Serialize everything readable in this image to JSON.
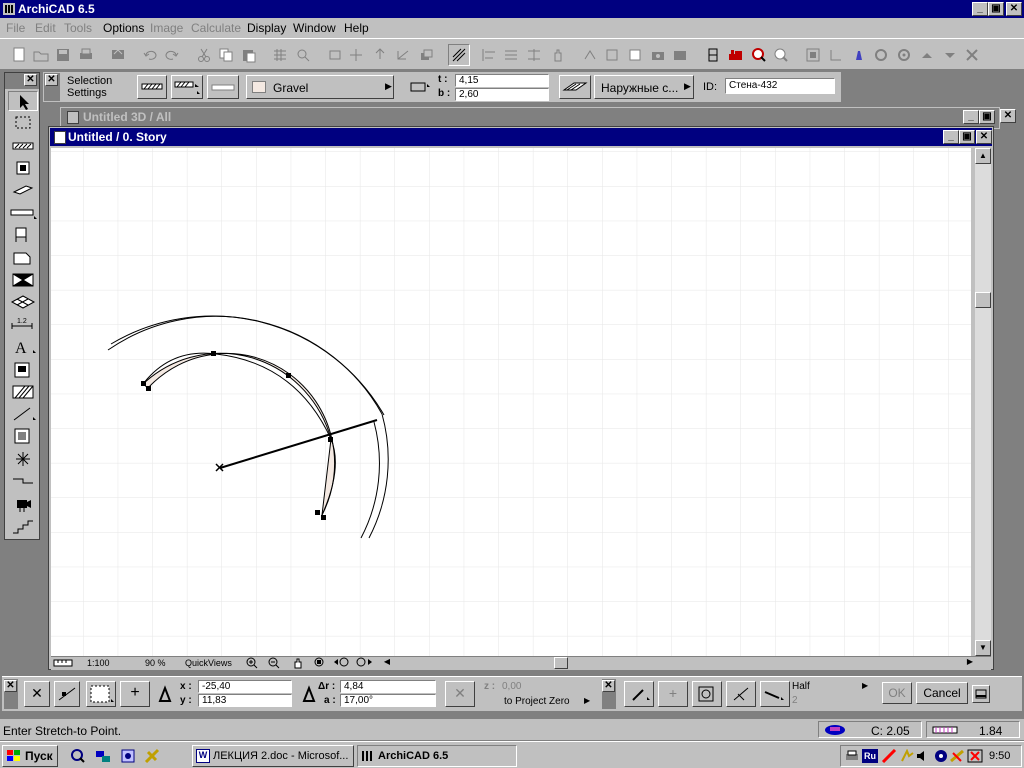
{
  "app": {
    "title": "ArchiCAD 6.5",
    "win_buttons": {
      "minimize": "_",
      "maximize": "▣",
      "close": "✕"
    }
  },
  "menu": [
    {
      "label": "File",
      "enabled": false
    },
    {
      "label": "Edit",
      "enabled": false
    },
    {
      "label": "Tools",
      "enabled": false
    },
    {
      "label": "Options",
      "enabled": true
    },
    {
      "label": "Image",
      "enabled": false
    },
    {
      "label": "Calculate",
      "enabled": false
    },
    {
      "label": "Display",
      "enabled": true
    },
    {
      "label": "Window",
      "enabled": true
    },
    {
      "label": "Help",
      "enabled": true
    }
  ],
  "infobox": {
    "selection_settings": "Selection\nSettings",
    "material": "Gravel",
    "t_label": "t :",
    "t_value": "4,15",
    "b_label": "b :",
    "b_value": "2,60",
    "layer": "Наружные с...",
    "id_label": "ID:",
    "id_value": "Стена-432"
  },
  "windows": {
    "background_title": "Untitled 3D / All",
    "plan_title": "Untitled / 0. Story"
  },
  "plan_bar": {
    "scale": "1:100",
    "zoom": "90 %",
    "quickviews": "QuickViews"
  },
  "control_box": {
    "x_label": "x :",
    "x_value": "-25,40",
    "y_label": "y :",
    "y_value": "11,83",
    "dr_label": "Δr :",
    "dr_value": "4,84",
    "a_label": "a :",
    "a_value": "17,00°",
    "z_label": "z :",
    "z_value": "0,00",
    "to_project_zero": "to Project Zero",
    "half_label": "Half",
    "half_value": "2",
    "ok": "OK",
    "cancel": "Cancel"
  },
  "status": {
    "message": "Enter Stretch-to Point.",
    "c_value": "C: 2.05",
    "right_value": "1.84"
  },
  "taskbar": {
    "start": "Пуск",
    "tasks": [
      {
        "label": "ЛЕКЦИЯ 2.doc - Microsof...",
        "active": false
      },
      {
        "label": "ArchiCAD 6.5",
        "active": true
      }
    ],
    "clock": "9:50",
    "lang": "Ru"
  },
  "colors": {
    "title_active": "#000080",
    "title_inactive": "#808080",
    "face": "#c0c0c0",
    "wall_fill": "#f4e9e2",
    "grid": "#e6e6e6"
  }
}
